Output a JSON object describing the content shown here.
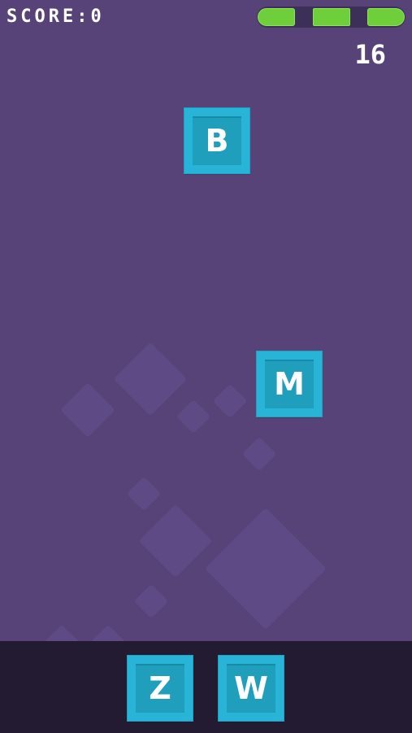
{
  "hud": {
    "score_label": "SCORE:0",
    "timer": "16",
    "lives": {
      "remaining": 3,
      "total": 3
    }
  },
  "falling_tiles": [
    {
      "letter": "B"
    },
    {
      "letter": "M"
    }
  ],
  "tray_tiles": [
    {
      "letter": "Z"
    },
    {
      "letter": "W"
    }
  ],
  "colors": {
    "background": "#574378",
    "tile": "#28b4d6",
    "tile_inner": "#209fbd",
    "life": "#6fcf3b",
    "tray": "#231b32"
  }
}
